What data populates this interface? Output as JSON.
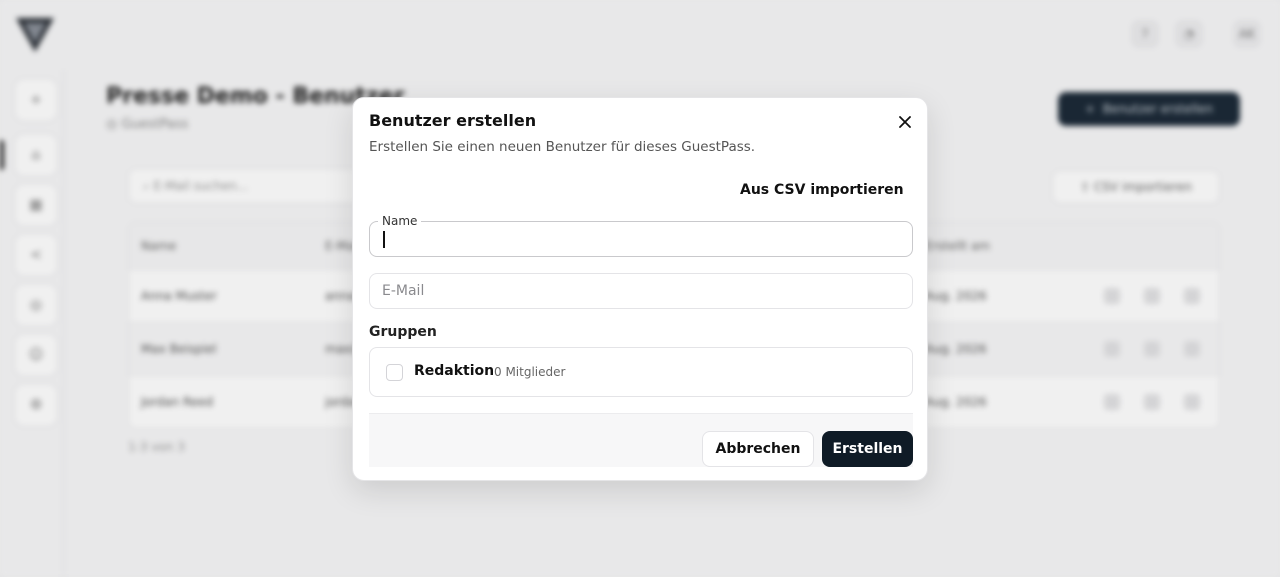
{
  "background": {
    "page_title": "Presse Demo - Benutzer",
    "page_subtitle": "GuestPass",
    "create_user_button": "Benutzer erstellen",
    "search_placeholder": "E-Mail suchen...",
    "csv_import_button": "CSV importieren",
    "table": {
      "headers": [
        "Name",
        "E-Mail",
        "Erstellt am"
      ],
      "rows": [
        {
          "name": "Anna Muster",
          "email": "anna@...",
          "created": "Aug. 2026"
        },
        {
          "name": "Max Beispiel",
          "email": "max@...",
          "created": "Aug. 2026"
        },
        {
          "name": "Jordan Reed",
          "email": "jordan@...",
          "created": "Aug. 2026"
        }
      ]
    },
    "pagination": "1-3 von 3",
    "user_avatar_initials": "AK"
  },
  "modal": {
    "title": "Benutzer erstellen",
    "description": "Erstellen Sie einen neuen Benutzer für dieses GuestPass.",
    "import_csv_label": "Aus CSV importieren",
    "name_label": "Name",
    "name_value": "",
    "email_placeholder": "E-Mail",
    "groups_label": "Gruppen",
    "groups": [
      {
        "name": "Redaktion",
        "members": "0 Mitglieder",
        "checked": false
      }
    ],
    "cancel_label": "Abbrechen",
    "submit_label": "Erstellen"
  },
  "colors": {
    "primary": "#0f1b26",
    "border": "#e4e4e7",
    "muted_text": "#555555"
  }
}
